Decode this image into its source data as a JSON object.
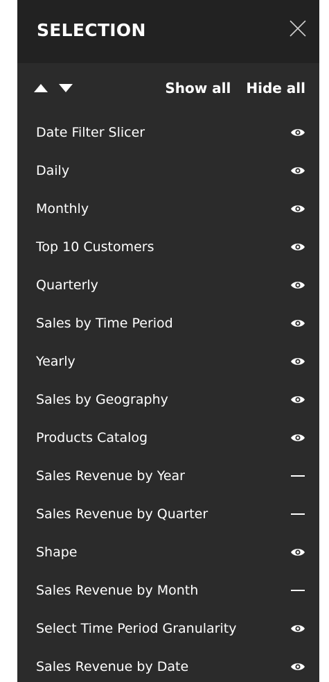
{
  "header": {
    "title": "SELECTION"
  },
  "toolbar": {
    "show_all": "Show all",
    "hide_all": "Hide all"
  },
  "items": [
    {
      "label": "Date Filter Slicer",
      "visible": true
    },
    {
      "label": "Daily",
      "visible": true
    },
    {
      "label": "Monthly",
      "visible": true
    },
    {
      "label": "Top 10 Customers",
      "visible": true
    },
    {
      "label": "Quarterly",
      "visible": true
    },
    {
      "label": "Sales by Time Period",
      "visible": true
    },
    {
      "label": "Yearly",
      "visible": true
    },
    {
      "label": "Sales by Geography",
      "visible": true
    },
    {
      "label": "Products Catalog",
      "visible": true
    },
    {
      "label": "Sales Revenue by Year",
      "visible": false
    },
    {
      "label": "Sales Revenue by Quarter",
      "visible": false
    },
    {
      "label": "Shape",
      "visible": true
    },
    {
      "label": "Sales Revenue by Month",
      "visible": false
    },
    {
      "label": "Select Time Period Granularity",
      "visible": true
    },
    {
      "label": "Sales Revenue by Date",
      "visible": true
    }
  ],
  "colors": {
    "panel_bg": "#2b2b2b",
    "header_bg": "#222222",
    "text": "#ffffff"
  }
}
